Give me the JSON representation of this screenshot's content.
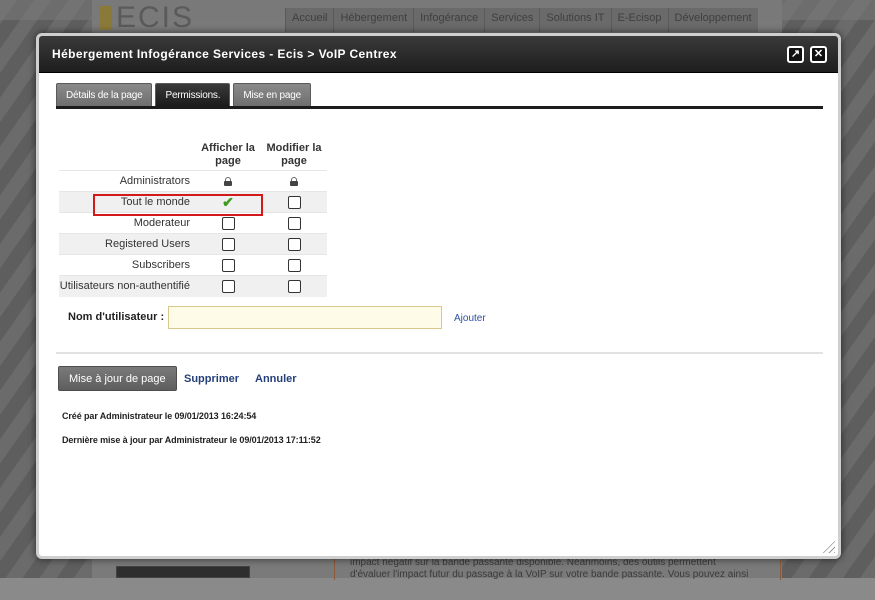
{
  "background": {
    "logo": "ECIS",
    "nav": [
      "Accueil",
      "Hébergement",
      "Infogérance",
      "Services",
      "Solutions IT",
      "E-Ecisop",
      "Développement"
    ],
    "text_lines": [
      "impact négatif sur la bande passante disponible. Néanmoins, des outils permettent",
      "d'évaluer l'impact futur du passage à la VoIP sur votre bande passante. Vous pouvez ainsi"
    ]
  },
  "dialog": {
    "title": "Hébergement Infogérance Services - Ecis > VoIP Centrex",
    "maximize_icon": "arrow-up-right-icon",
    "close_icon": "close-x-icon"
  },
  "tabs": [
    {
      "label": "Détails de la page",
      "active": false
    },
    {
      "label": "Permissions.",
      "active": true
    },
    {
      "label": "Mise en page",
      "active": false
    }
  ],
  "permissions": {
    "columns": [
      "Afficher la page",
      "Modifier la page"
    ],
    "rows": [
      {
        "role": "Administrators",
        "view": "locked",
        "edit": "locked"
      },
      {
        "role": "Tout le monde",
        "view": "checked",
        "edit": "unchecked"
      },
      {
        "role": "Moderateur",
        "view": "unchecked",
        "edit": "unchecked"
      },
      {
        "role": "Registered Users",
        "view": "unchecked",
        "edit": "unchecked"
      },
      {
        "role": "Subscribers",
        "view": "unchecked",
        "edit": "unchecked"
      },
      {
        "role": "Utilisateurs non-authentifié",
        "view": "unchecked",
        "edit": "unchecked"
      }
    ],
    "highlight_color": "#d21a1a",
    "check_color": "#3c9b1e"
  },
  "username": {
    "label": "Nom d'utilisateur :",
    "value": "",
    "add_label": "Ajouter"
  },
  "actions": {
    "update_label": "Mise à jour de page",
    "delete_label": "Supprimer",
    "cancel_label": "Annuler"
  },
  "meta": {
    "created": "Créé par Administrateur le 09/01/2013 16:24:54",
    "updated": "Dernière mise à jour par Administrateur le 09/01/2013 17:11:52"
  }
}
